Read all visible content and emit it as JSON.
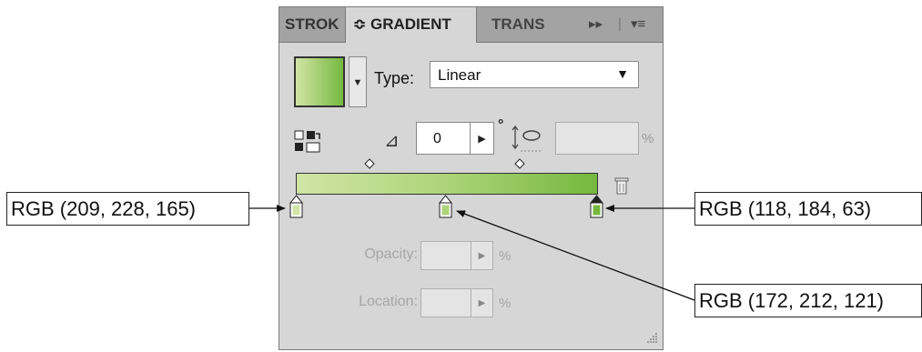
{
  "panel": {
    "tabs": [
      {
        "label": "STROK"
      },
      {
        "label": "≎ GRADIENT"
      },
      {
        "label": "TRANS"
      }
    ],
    "forward_glyph": "▸▸",
    "menu_glyph": "▾≡",
    "type_label": "Type:",
    "type_value": "Linear",
    "angle_value": "0",
    "degree_symbol": "°",
    "aspect_percent": "%",
    "opacity_label": "Opacity:",
    "location_label": "Location:",
    "opacity_percent": "%",
    "location_percent": "%"
  },
  "gradient": {
    "stops": [
      {
        "color": "#d1e4a5",
        "location": 0
      },
      {
        "color": "#acd479",
        "location": 50
      },
      {
        "color": "#76b83f",
        "location": 100
      }
    ]
  },
  "callouts": {
    "left": "RGB (209, 228, 165)",
    "right_top": "RGB (118, 184, 63)",
    "right_bottom": "RGB (172, 212, 121)"
  }
}
